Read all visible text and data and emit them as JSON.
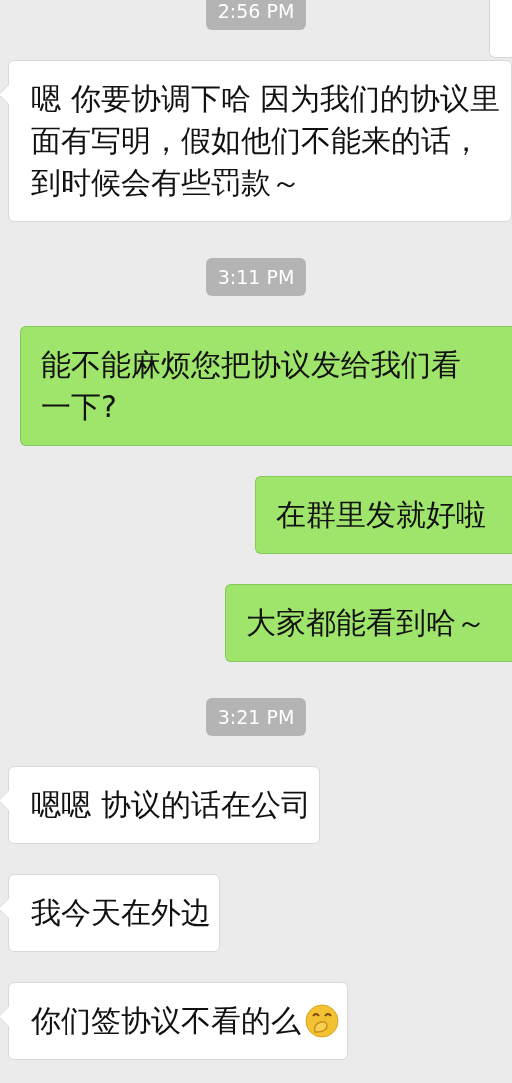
{
  "messages": [
    {
      "kind": "time",
      "text": "2:56 PM"
    },
    {
      "kind": "received",
      "text": "嗯 你要协调下哈 因为我们的协议里面有写明，假如他们不能来的话，到时候会有些罚款～"
    },
    {
      "kind": "time",
      "text": "3:11 PM"
    },
    {
      "kind": "sent",
      "text": "能不能麻烦您把协议发给我们看一下?"
    },
    {
      "kind": "sent",
      "text": "在群里发就好啦"
    },
    {
      "kind": "sent",
      "text": "大家都能看到哈～"
    },
    {
      "kind": "time",
      "text": "3:21 PM"
    },
    {
      "kind": "received",
      "text": "嗯嗯 协议的话在公司"
    },
    {
      "kind": "received",
      "text": "我今天在外边"
    },
    {
      "kind": "received",
      "text": "你们签协议不看的么",
      "emoji": true
    }
  ]
}
